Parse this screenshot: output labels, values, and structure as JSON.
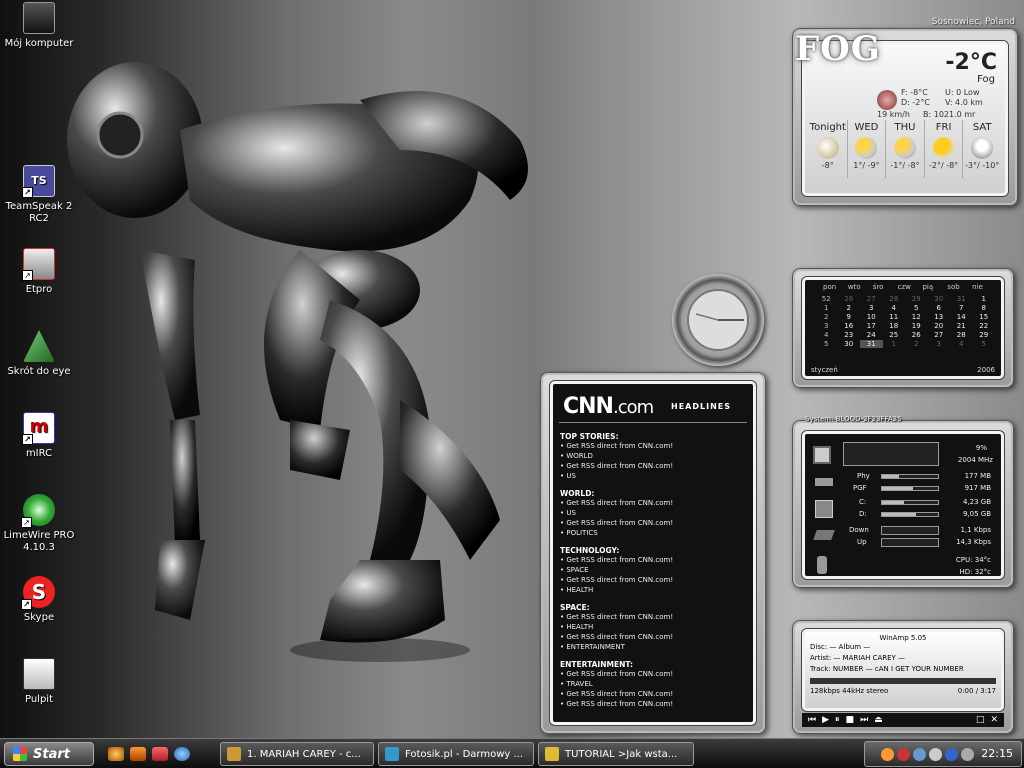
{
  "desktop_icons": [
    {
      "label": "Mój komputer",
      "icon": "computer-icon"
    },
    {
      "label": "TeamSpeak 2 RC2",
      "icon": "teamspeak-icon"
    },
    {
      "label": "Etpro",
      "icon": "etpro-icon"
    },
    {
      "label": "Skrót do eye",
      "icon": "eye-icon"
    },
    {
      "label": "mIRC",
      "icon": "mirc-icon"
    },
    {
      "label": "LimeWire PRO 4.10.3",
      "icon": "limewire-icon"
    },
    {
      "label": "Skype",
      "icon": "skype-icon"
    },
    {
      "label": "Pulpit",
      "icon": "pulpit-icon"
    }
  ],
  "weather": {
    "logo": "FOG",
    "city": "Sosnowiec, Poland",
    "temp": "-2°C",
    "condition": "Fog",
    "feels": "F: -8°C",
    "dew": "D: -2°C",
    "uv": "U:   0 Low",
    "visibility": "V: 4.0 km",
    "wind": "19 km/h",
    "baro": "B:   1021.0 mr",
    "days": [
      {
        "name": "Tonight",
        "range": "-8°",
        "icon": "moon-icon"
      },
      {
        "name": "WED",
        "range": "1°/ -9°",
        "icon": "partly-cloudy-icon"
      },
      {
        "name": "THU",
        "range": "-1°/ -8°",
        "icon": "partly-cloudy-icon"
      },
      {
        "name": "FRI",
        "range": "-2°/ -8°",
        "icon": "sun-cloud-icon"
      },
      {
        "name": "SAT",
        "range": "-3°/ -10°",
        "icon": "snow-icon"
      }
    ]
  },
  "calendar": {
    "headers": [
      "pon",
      "wto",
      "śro",
      "czw",
      "pią",
      "sob",
      "nie"
    ],
    "weeks": [
      [
        "52",
        "26",
        "27",
        "28",
        "29",
        "30",
        "31",
        "1"
      ],
      [
        "1",
        "2",
        "3",
        "4",
        "5",
        "6",
        "7",
        "8"
      ],
      [
        "2",
        "9",
        "10",
        "11",
        "12",
        "13",
        "14",
        "15"
      ],
      [
        "3",
        "16",
        "17",
        "18",
        "19",
        "20",
        "21",
        "22"
      ],
      [
        "4",
        "23",
        "24",
        "25",
        "26",
        "27",
        "28",
        "29"
      ],
      [
        "5",
        "30",
        "31",
        "1",
        "2",
        "3",
        "4",
        "5"
      ]
    ],
    "month": "styczeń",
    "year": "2006"
  },
  "cnn": {
    "logo": "CNN",
    "logo_suffix": ".com",
    "headlines": "HEADLINES",
    "sections": [
      {
        "title": "TOP STORIES:",
        "items": [
          "• Get RSS direct from CNN.com!",
          "• WORLD",
          "• Get RSS direct from CNN.com!",
          "• US"
        ]
      },
      {
        "title": "WORLD:",
        "items": [
          "• Get RSS direct from CNN.com!",
          "• US",
          "• Get RSS direct from CNN.com!",
          "• POLITICS"
        ]
      },
      {
        "title": "TECHNOLOGY:",
        "items": [
          "• Get RSS direct from CNN.com!",
          "• SPACE",
          "• Get RSS direct from CNN.com!",
          "• HEALTH"
        ]
      },
      {
        "title": "SPACE:",
        "items": [
          "• Get RSS direct from CNN.com!",
          "• HEALTH",
          "• Get RSS direct from CNN.com!",
          "• ENTERTAINMENT"
        ]
      },
      {
        "title": "ENTERTAINMENT:",
        "items": [
          "• Get RSS direct from CNN.com!",
          "• TRAVEL",
          "• Get RSS direct from CNN.com!",
          "• Get RSS direct from CNN.com!"
        ]
      }
    ]
  },
  "system": {
    "title": "System: BLOOD-2F23FFA25",
    "cpu_percent": "9%",
    "cpu_mhz": "2004 MHz",
    "phy_label": "Phy",
    "phy_value": "177 MB",
    "phy_fill": 0.3,
    "pgf_label": "PGF",
    "pgf_value": "917 MB",
    "pgf_fill": 0.55,
    "c_label": "C:",
    "c_value": "4,23 GB",
    "c_fill": 0.4,
    "d_label": "D:",
    "d_value": "9,05 GB",
    "d_fill": 0.6,
    "down_label": "Down",
    "down_value": "1,1 Kbps",
    "up_label": "Up",
    "up_value": "14,3 Kbps",
    "cpu_temp": "CPU:  34°c",
    "hd_temp": "HD:  32°c"
  },
  "winamp": {
    "title": "WinAmp 5.05",
    "disc": "Disc:  —   Album  —",
    "artist": "Artist:  —   MARIAH CAREY  —",
    "track": "Track: NUMBER  —  cAN I GET YOUR NUMBER",
    "bitrate": "128kbps  44kHz stereo",
    "time": "0:00 / 3:17"
  },
  "taskbar": {
    "start": "Start",
    "tasks": [
      {
        "label": "1. MARIAH CAREY - c...",
        "icon": "winamp-icon"
      },
      {
        "label": "Fotosik.pl - Darmowy ...",
        "icon": "browser-icon"
      },
      {
        "label": "TUTORIAL >Jak wsta...",
        "icon": "folder-icon"
      }
    ],
    "clock": "22:15"
  },
  "colors": {
    "accent": "#c8c8c8",
    "dark": "#111111"
  }
}
